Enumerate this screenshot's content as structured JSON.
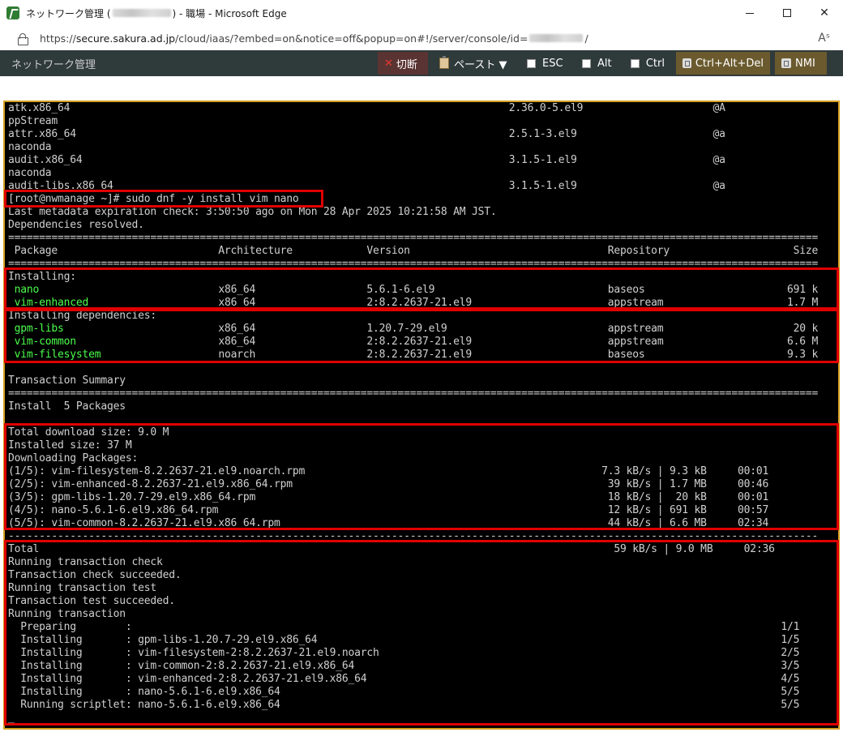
{
  "window": {
    "title_prefix": "ネットワーク管理 (",
    "title_suffix": ") - 職場 - Microsoft Edge",
    "url_prefix": "https://",
    "url_host": "secure.sakura.ad.jp",
    "url_path": "/cloud/iaas/?embed=on&notice=off&popup=on#!/server/console/id=",
    "url_end": "/",
    "read_aloud_label": "Aˢ"
  },
  "toolbar": {
    "title": "ネットワーク管理",
    "kill_label": "切断",
    "paste_label": "ペースト ▼",
    "esc_label": "ESC",
    "alt_label": "Alt",
    "ctrl_label": "Ctrl",
    "cad_label": "Ctrl+Alt+Del",
    "nmi_label": "NMI"
  },
  "terminal": {
    "lines": [
      "atk.x86_64                                                                       2.36.0-5.el9                     @A",
      "ppStream",
      "attr.x86_64                                                                      2.5.1-3.el9                      @a",
      "naconda",
      "audit.x86_64                                                                     3.1.5-1.el9                      @a",
      "naconda",
      "audit-libs.x86_64                                                                3.1.5-1.el9                      @a",
      "[root@nwmanage ~]# sudo dnf -y install vim nano",
      "Last metadata expiration check: 3:50:50 ago on Mon 28 Apr 2025 10:21:58 AM JST.",
      "Dependencies resolved.",
      "===================================================================================================================================",
      " Package                          Architecture            Version                                Repository                    Size",
      "===================================================================================================================================",
      "Installing:",
      " nano                             x86_64                  5.6.1-6.el9                            baseos                       691 k",
      " vim-enhanced                     x86_64                  2:8.2.2637-21.el9                      appstream                    1.7 M",
      "Installing dependencies:",
      " gpm-libs                         x86_64                  1.20.7-29.el9                          appstream                     20 k",
      " vim-common                       x86_64                  2:8.2.2637-21.el9                      appstream                    6.6 M",
      " vim-filesystem                   noarch                  2:8.2.2637-21.el9                      baseos                       9.3 k",
      "",
      "Transaction Summary",
      "===================================================================================================================================",
      "Install  5 Packages",
      "",
      "Total download size: 9.0 M",
      "Installed size: 37 M",
      "Downloading Packages:",
      "(1/5): vim-filesystem-8.2.2637-21.el9.noarch.rpm                                                7.3 kB/s | 9.3 kB     00:01",
      "(2/5): vim-enhanced-8.2.2637-21.el9.x86_64.rpm                                                   39 kB/s | 1.7 MB     00:46",
      "(3/5): gpm-libs-1.20.7-29.el9.x86_64.rpm                                                         18 kB/s |  20 kB     00:01",
      "(4/5): nano-5.6.1-6.el9.x86_64.rpm                                                               12 kB/s | 691 kB     00:57",
      "(5/5): vim-common-8.2.2637-21.el9.x86_64.rpm                                                     44 kB/s | 6.6 MB     02:34",
      "-----------------------------------------------------------------------------------------------------------------------------------",
      "Total                                                                                             59 kB/s | 9.0 MB     02:36",
      "Running transaction check",
      "Transaction check succeeded.",
      "Running transaction test",
      "Transaction test succeeded.",
      "Running transaction",
      "  Preparing        :                                                                                                         1/1",
      "  Installing       : gpm-libs-1.20.7-29.el9.x86_64                                                                           1/5",
      "  Installing       : vim-filesystem-2:8.2.2637-21.el9.noarch                                                                 2/5",
      "  Installing       : vim-common-2:8.2.2637-21.el9.x86_64                                                                     3/5",
      "  Installing       : vim-enhanced-2:8.2.2637-21.el9.x86_64                                                                   4/5",
      "  Installing       : nano-5.6.1-6.el9.x86_64                                                                                 5/5",
      "  Running scriptlet: nano-5.6.1-6.el9.x86_64                                                                                 5/5",
      "_"
    ],
    "green_packages": [
      "nano",
      "vim-enhanced",
      "gpm-libs",
      "vim-common",
      "vim-filesystem"
    ]
  },
  "colors": {
    "highlight": "#e00000",
    "screen_border": "#d4a020",
    "terminal_bg": "#000000",
    "terminal_fg": "#d0d0d0",
    "package_green": "#4cff4c",
    "toolbar_bg": "#2f3a3b"
  }
}
